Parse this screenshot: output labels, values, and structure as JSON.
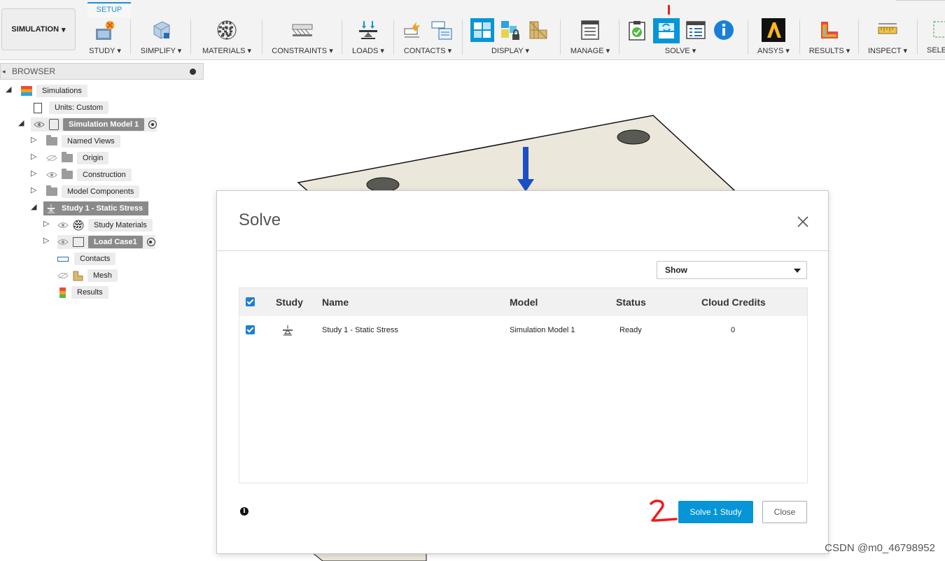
{
  "workspace": {
    "label": "SIMULATION"
  },
  "ribbon": {
    "active_tab": "SETUP",
    "groups": [
      {
        "label": "STUDY",
        "arrow": "▾"
      },
      {
        "label": "SIMPLIFY",
        "arrow": "▾"
      },
      {
        "label": "MATERIALS",
        "arrow": "▾"
      },
      {
        "label": "CONSTRAINTS",
        "arrow": "▾"
      },
      {
        "label": "LOADS",
        "arrow": "▾"
      },
      {
        "label": "CONTACTS",
        "arrow": "▾"
      },
      {
        "label": "DISPLAY",
        "arrow": "▾"
      },
      {
        "label": "MANAGE",
        "arrow": "▾"
      },
      {
        "label": "SOLVE",
        "arrow": "▾"
      },
      {
        "label": "ANSYS",
        "arrow": "▾"
      },
      {
        "label": "RESULTS",
        "arrow": "▾"
      },
      {
        "label": "INSPECT",
        "arrow": "▾"
      },
      {
        "label": "SELE"
      }
    ],
    "accent": "#0696d7"
  },
  "browser": {
    "title": "BROWSER",
    "nodes": [
      {
        "label": "Simulations"
      },
      {
        "label": "Units: Custom"
      },
      {
        "label": "Simulation Model 1"
      },
      {
        "label": "Named Views"
      },
      {
        "label": "Origin"
      },
      {
        "label": "Construction"
      },
      {
        "label": "Model Components"
      },
      {
        "label": "Study 1 - Static Stress"
      },
      {
        "label": "Study Materials"
      },
      {
        "label": "Load Case1"
      },
      {
        "label": "Contacts"
      },
      {
        "label": "Mesh"
      },
      {
        "label": "Results"
      }
    ]
  },
  "dialog": {
    "title": "Solve",
    "filter": {
      "selected": "Show"
    },
    "columns": [
      "Study",
      "Name",
      "Model",
      "Status",
      "Cloud Credits"
    ],
    "rows": [
      {
        "name": "Study 1 - Static Stress",
        "model": "Simulation Model 1",
        "status": "Ready",
        "credits": "0"
      }
    ],
    "solve_button": "Solve 1 Study",
    "close_button": "Close"
  },
  "annotations": {
    "mark_1": "1",
    "mark_2": "2",
    "color": "#ee1c1c"
  },
  "watermark": "CSDN @m0_46798952"
}
